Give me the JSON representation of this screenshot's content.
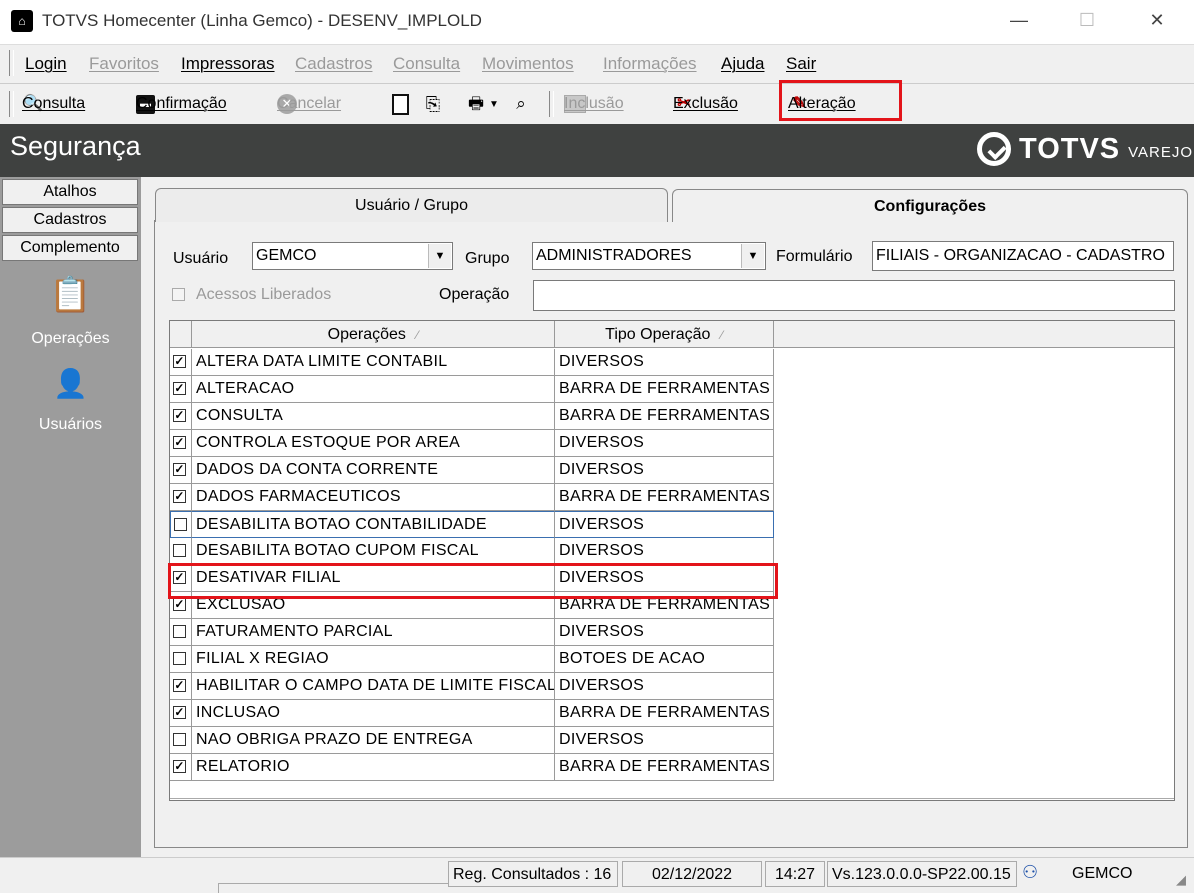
{
  "window": {
    "title": "TOTVS Homecenter (Linha Gemco) - DESENV_IMPLOLD",
    "minimize": "—",
    "maximize": "☐",
    "close": "✕"
  },
  "menu": {
    "items": [
      {
        "label": "Login",
        "enabled": true
      },
      {
        "label": "Favoritos",
        "enabled": false
      },
      {
        "label": "Impressoras",
        "enabled": true
      },
      {
        "label": "Cadastros",
        "enabled": false
      },
      {
        "label": "Consulta",
        "enabled": false
      },
      {
        "label": "Movimentos",
        "enabled": false
      },
      {
        "label": "Informações",
        "enabled": false
      },
      {
        "label": "Ajuda",
        "enabled": true
      },
      {
        "label": "Sair",
        "enabled": true
      }
    ]
  },
  "toolbar": {
    "consulta": "Consulta",
    "confirmacao": "Confirmação",
    "cancelar": "Cancelar",
    "inclusao": "Inclusão",
    "exclusao": "Exclusão",
    "alteracao": "Alteração"
  },
  "header": {
    "title": "Segurança",
    "logo_text": "TOTVS",
    "logo_sub": "VAREJO"
  },
  "sidebar": {
    "tabs": [
      "Atalhos",
      "Cadastros",
      "Complemento"
    ],
    "items": [
      {
        "label": "Operações",
        "icon": "operations-icon"
      },
      {
        "label": "Usuários",
        "icon": "users-icon"
      }
    ]
  },
  "tabs": {
    "usuario_grupo": "Usuário  / Grupo",
    "configuracoes": "Configurações"
  },
  "form": {
    "usuario_label": "Usuário",
    "usuario_value": "GEMCO",
    "grupo_label": "Grupo",
    "grupo_value": "ADMINISTRADORES",
    "formulario_label": "Formulário",
    "formulario_value": "FILIAIS - ORGANIZACAO - CADASTRO",
    "acessos_label": "Acessos Liberados",
    "operacao_label": "Operação",
    "operacao_value": ""
  },
  "grid": {
    "columns": [
      "Operações",
      "Tipo Operação"
    ],
    "rows": [
      {
        "checked": true,
        "op": "ALTERA DATA LIMITE CONTABIL",
        "tipo": "DIVERSOS"
      },
      {
        "checked": true,
        "op": "ALTERACAO",
        "tipo": "BARRA DE FERRAMENTAS"
      },
      {
        "checked": true,
        "op": "CONSULTA",
        "tipo": "BARRA DE FERRAMENTAS"
      },
      {
        "checked": true,
        "op": "CONTROLA ESTOQUE POR AREA",
        "tipo": "DIVERSOS"
      },
      {
        "checked": true,
        "op": "DADOS DA CONTA CORRENTE",
        "tipo": "DIVERSOS"
      },
      {
        "checked": true,
        "op": "DADOS FARMACEUTICOS",
        "tipo": "BARRA DE FERRAMENTAS"
      },
      {
        "checked": false,
        "op": "DESABILITA BOTAO CONTABILIDADE",
        "tipo": "DIVERSOS"
      },
      {
        "checked": false,
        "op": "DESABILITA BOTAO CUPOM FISCAL",
        "tipo": "DIVERSOS"
      },
      {
        "checked": true,
        "op": "DESATIVAR FILIAL",
        "tipo": "DIVERSOS"
      },
      {
        "checked": true,
        "op": "EXCLUSAO",
        "tipo": "BARRA DE FERRAMENTAS"
      },
      {
        "checked": false,
        "op": "FATURAMENTO PARCIAL",
        "tipo": "DIVERSOS"
      },
      {
        "checked": false,
        "op": "FILIAL X REGIAO",
        "tipo": "BOTOES DE ACAO"
      },
      {
        "checked": true,
        "op": "HABILITAR O CAMPO DATA DE LIMITE FISCAL",
        "tipo": "DIVERSOS"
      },
      {
        "checked": true,
        "op": "INCLUSAO",
        "tipo": "BARRA DE FERRAMENTAS"
      },
      {
        "checked": false,
        "op": "NAO OBRIGA PRAZO DE ENTREGA",
        "tipo": "DIVERSOS"
      },
      {
        "checked": true,
        "op": "RELATORIO",
        "tipo": "BARRA DE FERRAMENTAS"
      }
    ]
  },
  "status": {
    "reg": "Reg. Consultados : 16",
    "date": "02/12/2022",
    "time": "14:27",
    "version": "Vs.123.0.0.0-SP22.00.15",
    "user": "GEMCO"
  },
  "colors": {
    "highlight": "#e3141a",
    "header_bg": "#3f4140",
    "sidebar_bg": "#9c9c9c"
  }
}
